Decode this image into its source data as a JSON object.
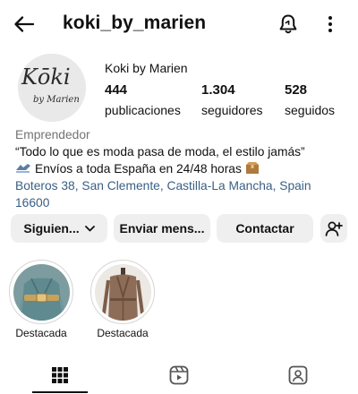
{
  "header": {
    "username": "koki_by_marien",
    "back_icon": "arrow-left-icon",
    "notifications_icon": "bell-icon",
    "more_icon": "more-vertical-icon"
  },
  "profile": {
    "display_name": "Koki by Marien",
    "avatar_logo_text": "Kōki",
    "avatar_logo_subtext": "by Marien",
    "stats": {
      "posts": {
        "value": "444",
        "label": "publicaciones"
      },
      "followers": {
        "value": "1.304",
        "label": "seguidores"
      },
      "following": {
        "value": "528",
        "label": "seguidos"
      }
    }
  },
  "bio": {
    "category": "Emprendedor",
    "quote": "“Todo lo que es moda pasa de moda, el estilo jamás”",
    "shipping": "Envíos a toda España en 24/48 horas",
    "shipping_emoji_left": "truck-icon",
    "shipping_emoji_right": "package-icon",
    "address_line1": "Boteros 38, San Clemente, Castilla-La Mancha, Spain",
    "address_line2": "16600",
    "link_color": "#3a5f85"
  },
  "actions": {
    "following_label": "Siguien...",
    "message_label": "Enviar mens...",
    "contact_label": "Contactar",
    "add_user_icon": "add-user-icon",
    "button_bg": "#efefef"
  },
  "highlights": [
    {
      "label": "Destacada"
    },
    {
      "label": "Destacada"
    }
  ],
  "tabs": [
    {
      "icon": "grid-icon",
      "active": true
    },
    {
      "icon": "reels-icon",
      "active": false
    },
    {
      "icon": "tagged-icon",
      "active": false
    }
  ]
}
